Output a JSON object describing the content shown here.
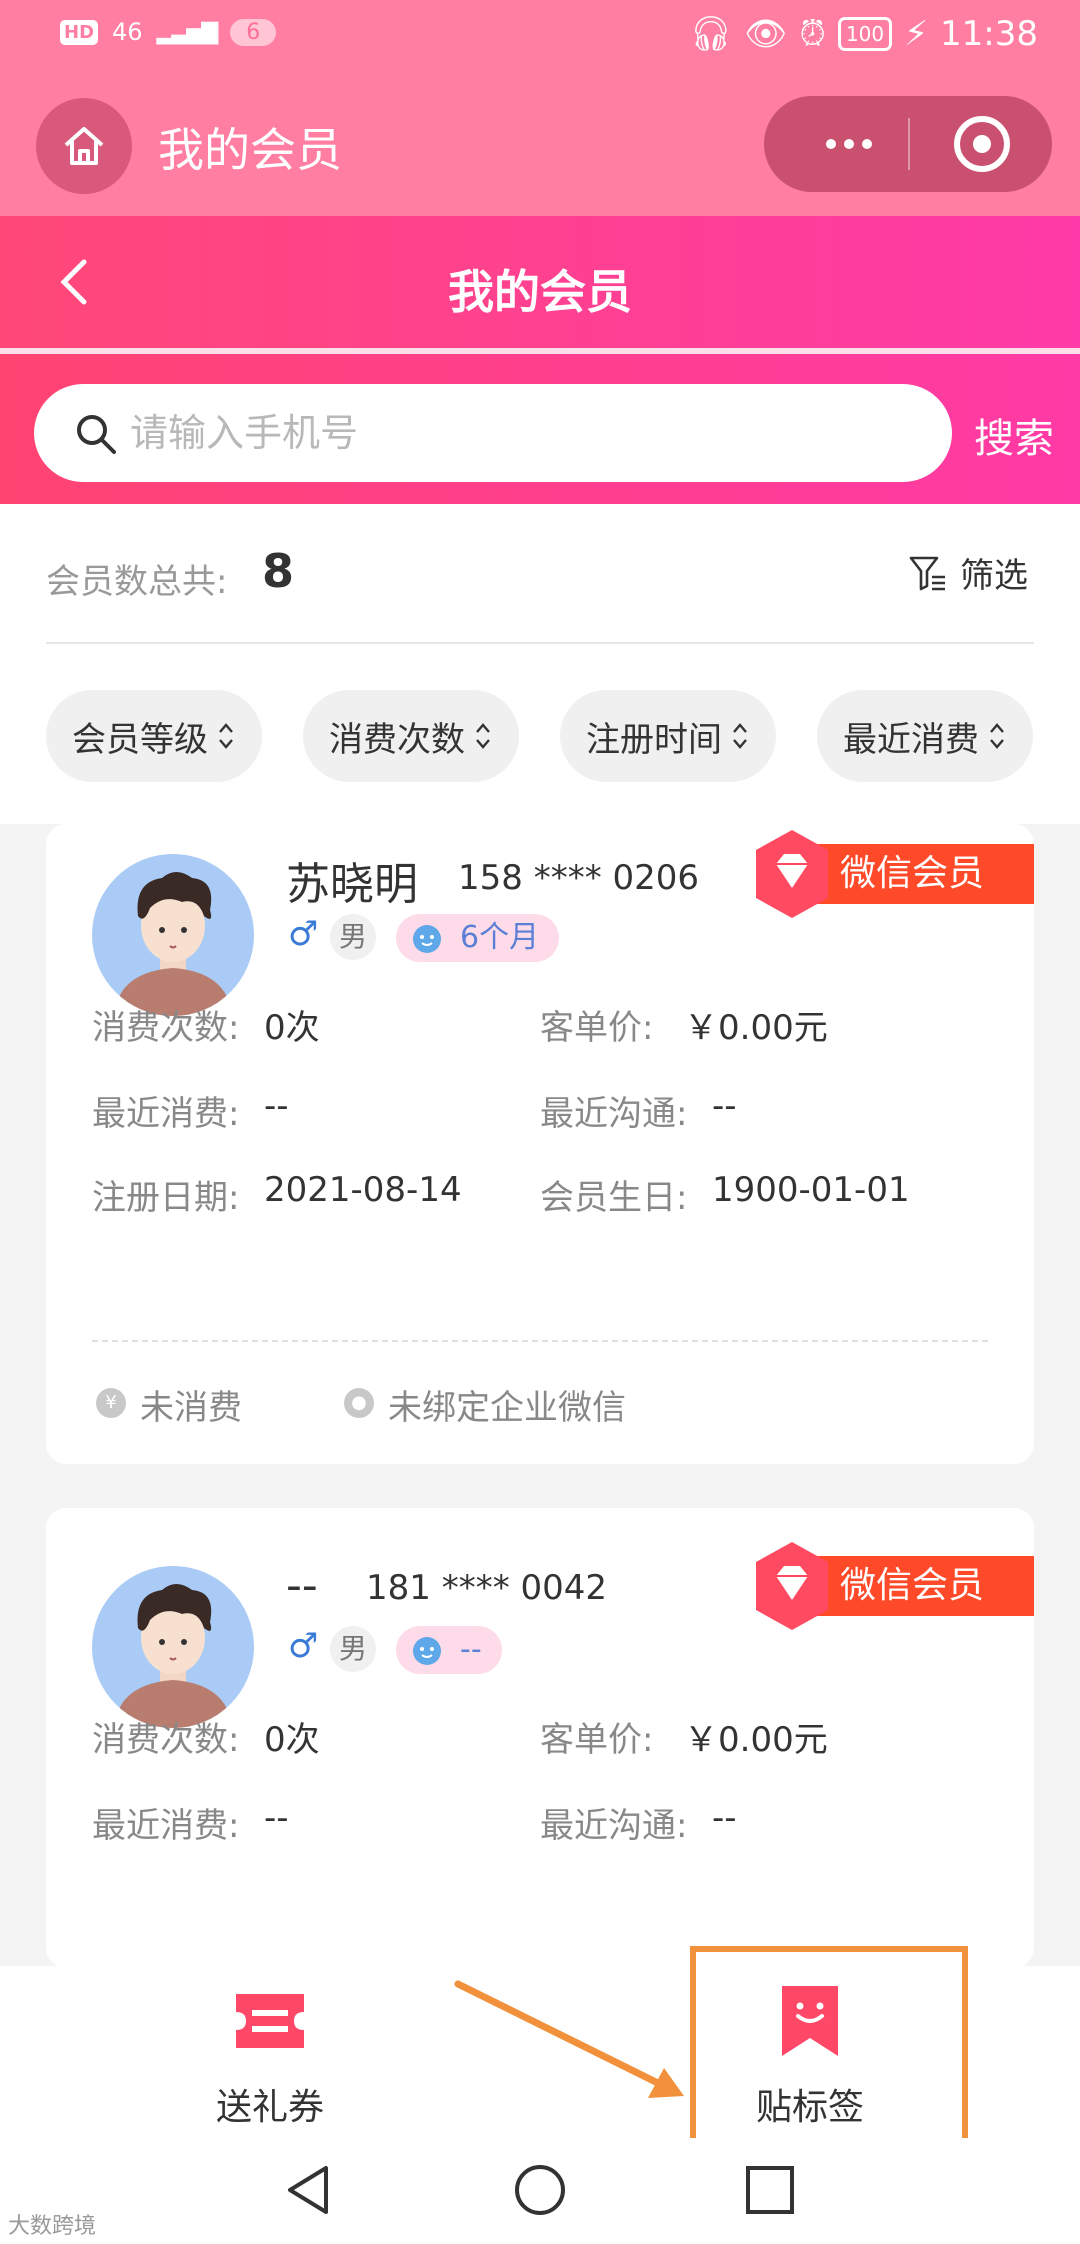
{
  "status_bar": {
    "hd": "HD",
    "network": "46",
    "notification_count": "6",
    "battery": "100",
    "time": "11:38"
  },
  "miniprogram": {
    "title": "我的会员"
  },
  "header": {
    "title": "我的会员"
  },
  "search": {
    "placeholder": "请输入手机号",
    "button": "搜索"
  },
  "summary": {
    "count_label": "会员数总共:",
    "count": "8",
    "filter": "筛选"
  },
  "sort_options": [
    "会员等级",
    "消费次数",
    "注册时间",
    "最近消费"
  ],
  "members": [
    {
      "name": "苏晓明",
      "phone": "158 **** 0206",
      "badge": "微信会员",
      "gender": "男",
      "age": "6个月",
      "stats": {
        "consume_count_label": "消费次数:",
        "consume_count": "0次",
        "avg_price_label": "客单价:",
        "avg_price": "￥0.00元",
        "last_consume_label": "最近消费:",
        "last_consume": "--",
        "last_contact_label": "最近沟通:",
        "last_contact": "--",
        "register_label": "注册日期:",
        "register": "2021-08-14",
        "birthday_label": "会员生日:",
        "birthday": "1900-01-01"
      },
      "footer": {
        "consume_status": "未消费",
        "wechat_status": "未绑定企业微信"
      }
    },
    {
      "name": "--",
      "phone": "181 **** 0042",
      "badge": "微信会员",
      "gender": "男",
      "age": "--",
      "stats": {
        "consume_count_label": "消费次数:",
        "consume_count": "0次",
        "avg_price_label": "客单价:",
        "avg_price": "￥0.00元",
        "last_consume_label": "最近消费:",
        "last_consume": "--",
        "last_contact_label": "最近沟通:",
        "last_contact": "--"
      }
    }
  ],
  "actions": {
    "send_coupon": "送礼券",
    "add_tag": "贴标签"
  },
  "watermark": "大数跨境",
  "colors": {
    "primary": "#ff4878",
    "badge": "#ff4a2a",
    "annotation": "#f2913c"
  }
}
